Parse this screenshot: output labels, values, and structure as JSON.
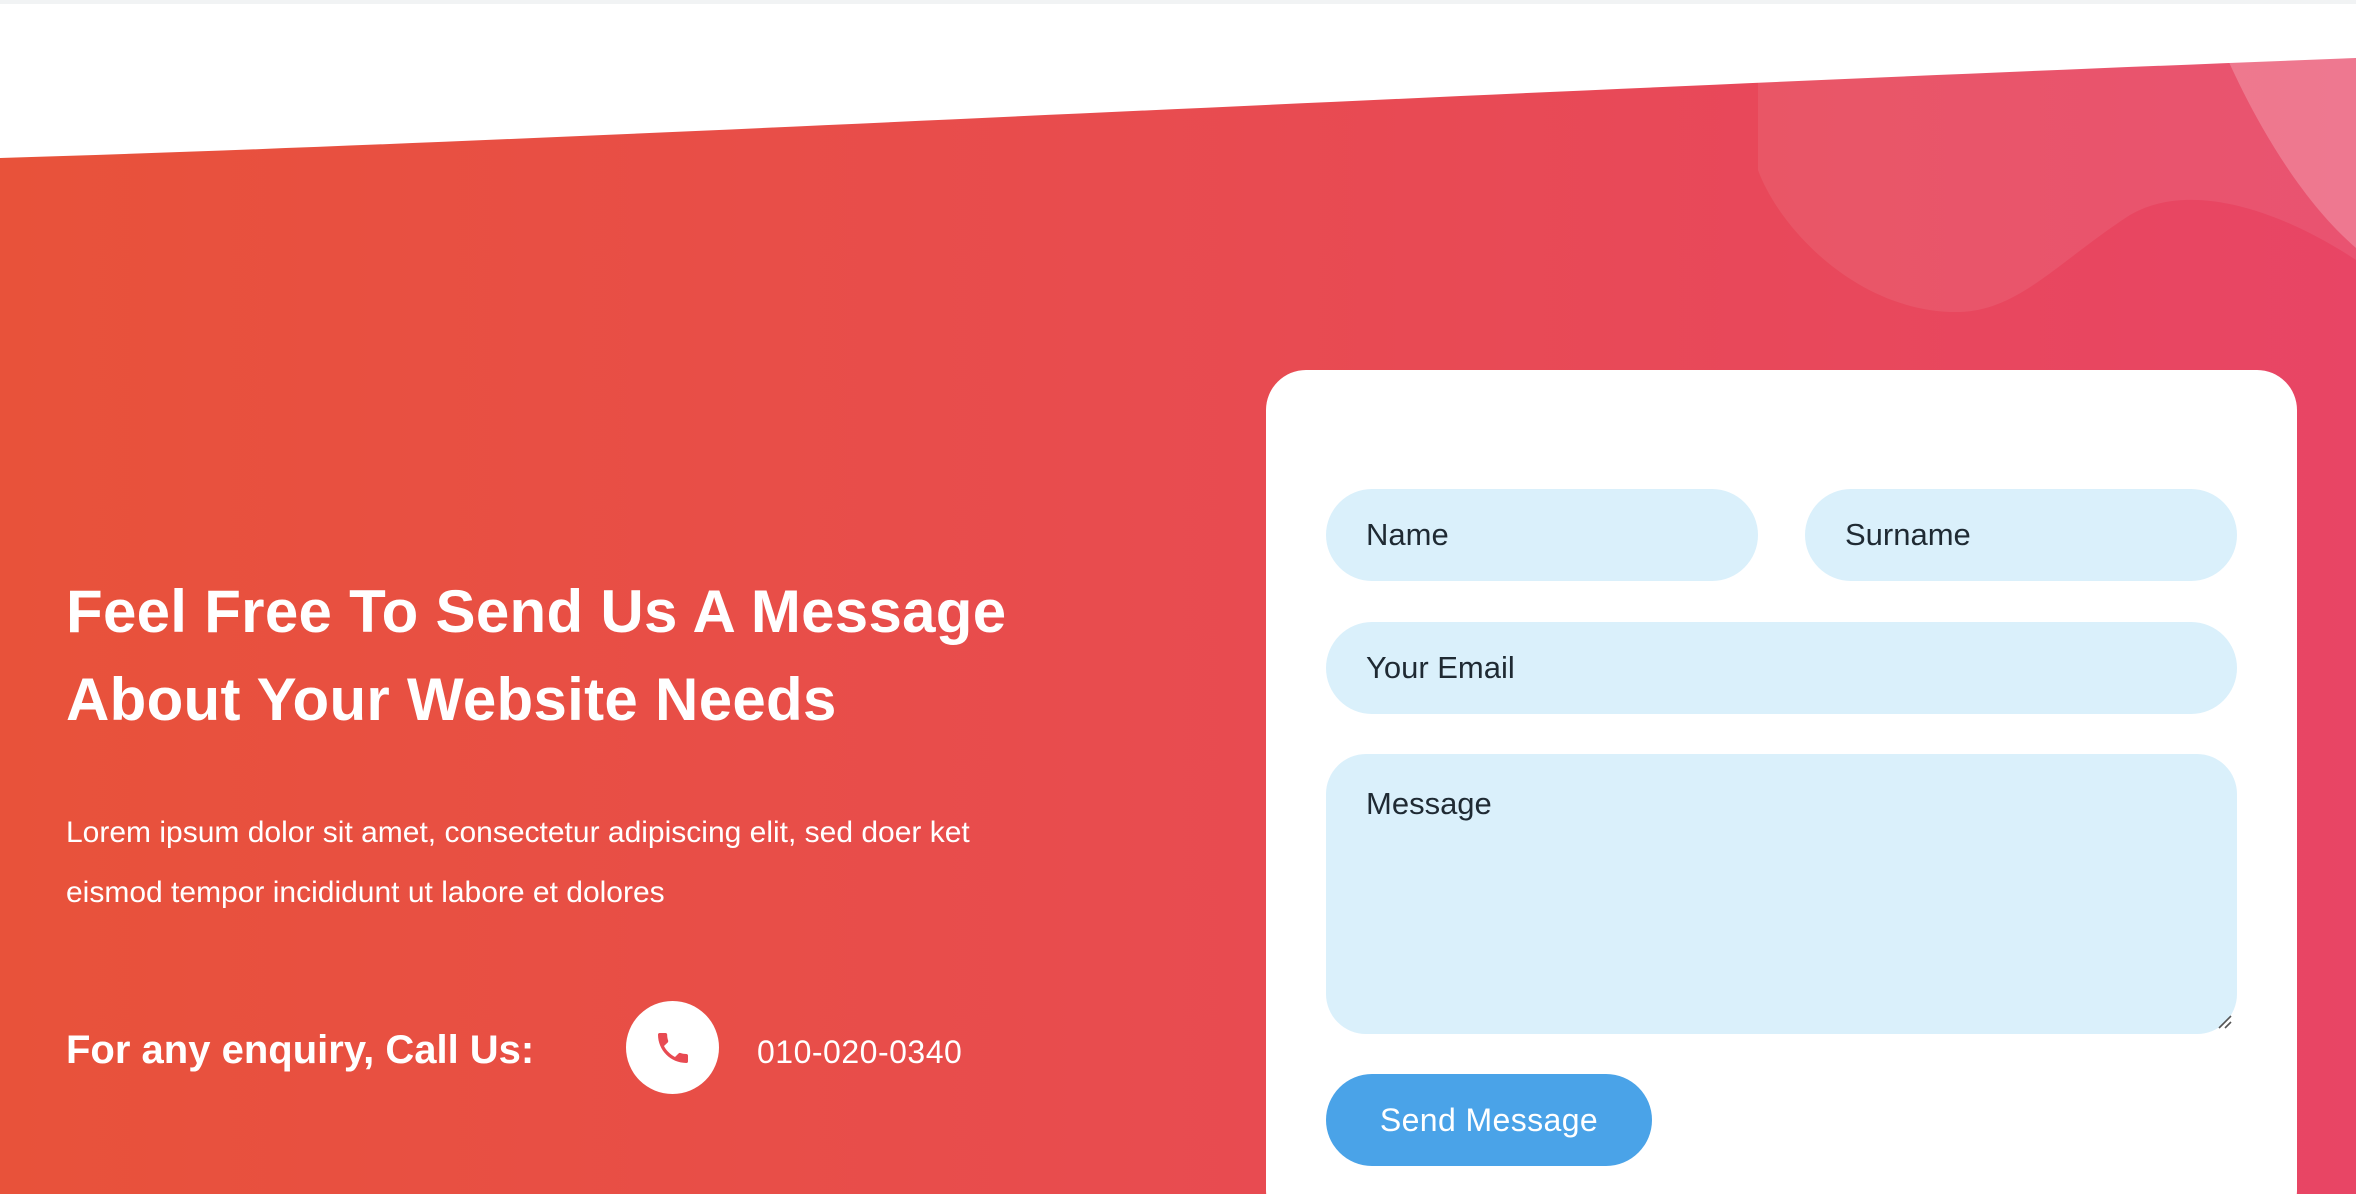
{
  "section": {
    "headline_line1": "Feel Free To Send Us A Message",
    "headline_line2": "About Your Website Needs",
    "body_line1": "Lorem ipsum dolor sit amet, consectetur adipiscing elit, sed doer ket",
    "body_line2": "eismod tempor incididunt ut labore et dolores",
    "enquiry_label": "For any enquiry, Call Us:",
    "phone_number": "010-020-0340",
    "phone_icon": "phone-icon"
  },
  "form": {
    "name_placeholder": "Name",
    "surname_placeholder": "Surname",
    "email_placeholder": "Your Email",
    "message_placeholder": "Message",
    "submit_label": "Send Message"
  },
  "colors": {
    "gradient_start": "#e8523a",
    "gradient_end": "#e84565",
    "field_background": "#daf0fb",
    "button_background": "#4aa3e8",
    "text_on_brand": "#ffffff"
  }
}
